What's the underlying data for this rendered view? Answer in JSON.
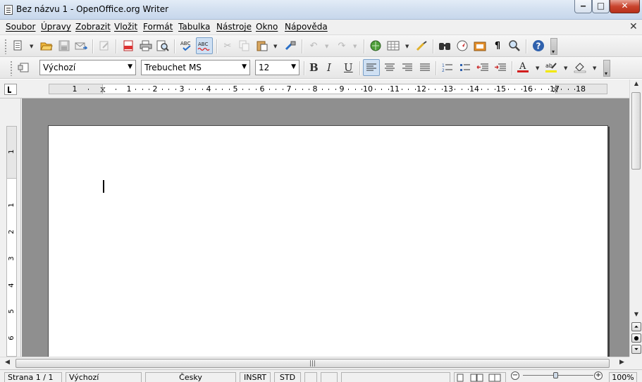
{
  "window": {
    "title": "Bez názvu 1 - OpenOffice.org Writer",
    "controls": {
      "minimize": "‒",
      "maximize": "□",
      "close": "✕"
    }
  },
  "menubar": {
    "items": [
      "Soubor",
      "Úpravy",
      "Zobrazit",
      "Vložit",
      "Formát",
      "Tabulka",
      "Nástroje",
      "Okno",
      "Nápověda"
    ],
    "close_document": "✕"
  },
  "standard_toolbar": {
    "icons": [
      "new-document-icon",
      "open-folder-icon",
      "save-icon",
      "email-icon",
      "edit-file-icon",
      "export-pdf-icon",
      "print-icon",
      "page-preview-icon",
      "spellcheck-icon",
      "autocheck-spelling-icon",
      "cut-icon",
      "copy-icon",
      "paste-icon",
      "clone-formatting-icon",
      "undo-icon",
      "redo-icon",
      "hyperlink-icon",
      "table-icon",
      "draw-functions-icon",
      "find-replace-icon",
      "navigator-icon",
      "gallery-icon",
      "nonprinting-chars-icon",
      "zoom-icon",
      "help-icon"
    ],
    "autocheck_label": "ABC",
    "spell_label": "ABC"
  },
  "formatting_toolbar": {
    "paragraph_style": "Výchozí",
    "font_name": "Trebuchet MS",
    "font_size": "12",
    "bold": "B",
    "italic": "I",
    "underline": "U",
    "highlight_label": "ab",
    "icons": [
      "styles-formatting-icon",
      "align-left-icon",
      "align-center-icon",
      "align-right-icon",
      "justify-icon",
      "numbering-icon",
      "bullets-icon",
      "decrease-indent-icon",
      "increase-indent-icon",
      "font-color-icon",
      "highlighting-icon",
      "background-color-icon"
    ]
  },
  "horizontal_ruler": {
    "labels": [
      "1",
      "1",
      "2",
      "3",
      "4",
      "5",
      "6",
      "7",
      "8",
      "9",
      "10",
      "11",
      "12",
      "13",
      "14",
      "15",
      "16",
      "17",
      "18"
    ]
  },
  "vertical_ruler": {
    "labels": [
      "1",
      "1",
      "2",
      "3",
      "4",
      "5",
      "6"
    ]
  },
  "statusbar": {
    "page": "Strana 1 / 1",
    "style": "Výchozí",
    "language": "Česky",
    "insert_mode": "INSRT",
    "selection_mode": "STD",
    "zoom": "100%"
  },
  "colors": {
    "accent_blue": "#2f61ad",
    "font_color_red": "#d21e1e",
    "highlight_yellow": "#f2e800",
    "doc_background": "#8f8f8f"
  }
}
